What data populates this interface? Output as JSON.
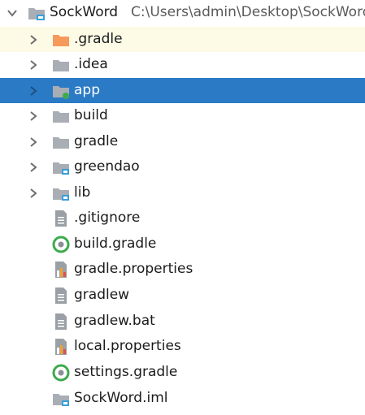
{
  "project": {
    "name": "SockWord",
    "path": "C:\\Users\\admin\\Desktop\\SockWord",
    "icon": "project-folder-icon"
  },
  "items": [
    {
      "label": ".gradle",
      "icon": "folder-orange-icon",
      "expandable": true
    },
    {
      "label": ".idea",
      "icon": "folder-icon",
      "expandable": true
    },
    {
      "label": "app",
      "icon": "module-folder-icon",
      "expandable": true,
      "selected": true
    },
    {
      "label": "build",
      "icon": "folder-icon",
      "expandable": true
    },
    {
      "label": "gradle",
      "icon": "folder-icon",
      "expandable": true
    },
    {
      "label": "greendao",
      "icon": "package-folder-icon",
      "expandable": true
    },
    {
      "label": "lib",
      "icon": "package-folder-icon",
      "expandable": true
    },
    {
      "label": ".gitignore",
      "icon": "text-file-icon",
      "expandable": false
    },
    {
      "label": "build.gradle",
      "icon": "gradle-file-icon",
      "expandable": false
    },
    {
      "label": "gradle.properties",
      "icon": "properties-file-icon",
      "expandable": false
    },
    {
      "label": "gradlew",
      "icon": "text-file-icon",
      "expandable": false
    },
    {
      "label": "gradlew.bat",
      "icon": "text-file-icon",
      "expandable": false
    },
    {
      "label": "local.properties",
      "icon": "properties-file-icon",
      "expandable": false
    },
    {
      "label": "settings.gradle",
      "icon": "gradle-file-icon",
      "expandable": false
    },
    {
      "label": "SockWord.iml",
      "icon": "module-file-icon",
      "expandable": false
    }
  ],
  "colors": {
    "selection": "#2a7ac6",
    "highlight_row": "#fdfbe6",
    "folder": "#a9aeb5",
    "orange_folder": "#f59a5a",
    "gradle_green": "#3cab4c",
    "module_blue": "#3a9fd8"
  }
}
